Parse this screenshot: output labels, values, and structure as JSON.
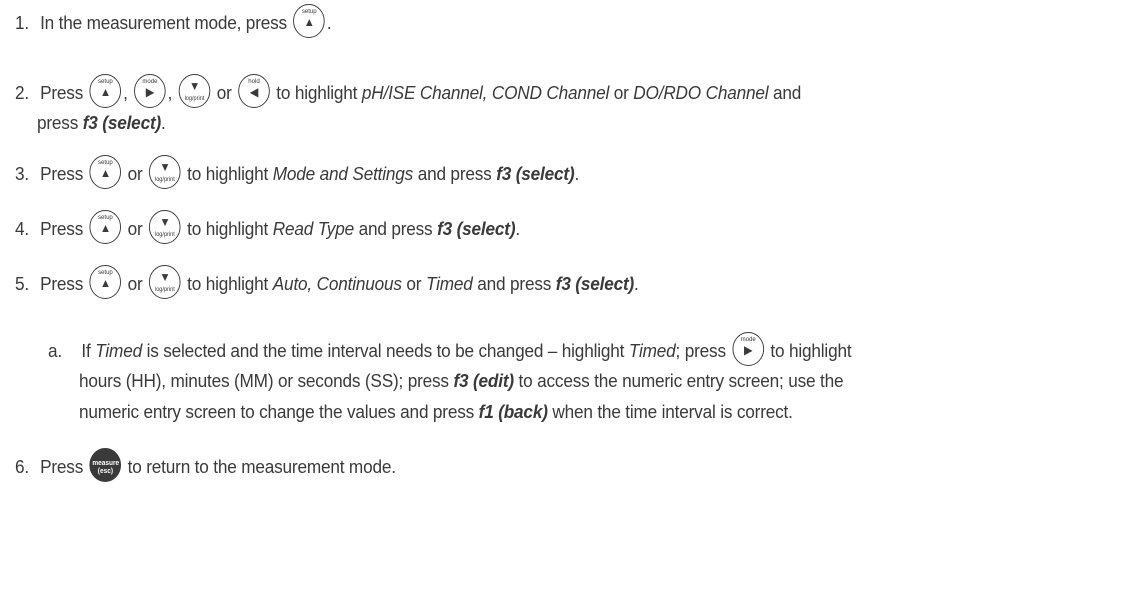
{
  "keys": {
    "setup": {
      "label": "setup",
      "glyph": "▲"
    },
    "mode": {
      "label": "mode",
      "glyph": "▶"
    },
    "logprint": {
      "label": "log/print",
      "glyph": "▼"
    },
    "hold": {
      "label": "hold",
      "glyph": "◀"
    },
    "measure": {
      "label_top": "measure",
      "label_bottom": "(esc)"
    }
  },
  "steps": [
    {
      "num": "1.",
      "t1": "In the measurement mode, press",
      "t2": "."
    },
    {
      "num": "2.",
      "t1": "Press",
      "sep1": ",",
      "sep2": ",",
      "or": "or",
      "t2": "to highlight",
      "opt1": "pH/ISE Channel, COND Channel",
      "or2": "or",
      "opt2": "DO/RDO Channel",
      "and": "and",
      "line2": "press",
      "action": "f3 (select)",
      "end": "."
    },
    {
      "num": "3.",
      "t1": "Press",
      "or": "or",
      "t2": "to highlight",
      "opt": "Mode and Settings",
      "t3": "and press",
      "action": "f3 (select)",
      "end": "."
    },
    {
      "num": "4.",
      "t1": "Press",
      "or": "or",
      "t2": "to highlight",
      "opt": "Read Type",
      "t3": "and press",
      "action": "f3 (select)",
      "end": "."
    },
    {
      "num": "5.",
      "t1": "Press",
      "or": "or",
      "t2": "to highlight",
      "opt1": "Auto, Continuous",
      "or2": "or",
      "opt2": "Timed",
      "t3": "and press",
      "action": "f3 (select)",
      "end": "."
    },
    {
      "num": "6.",
      "t1": "Press",
      "t2": "to return to the measurement mode."
    }
  ],
  "substep": {
    "letter": "a.",
    "t1": "If",
    "timed1": "Timed",
    "t2": "is selected and the time interval needs to be changed – highlight",
    "timed2": "Timed",
    "t3": "; press",
    "t4": "to highlight",
    "line2a": "hours (HH), minutes (MM) or seconds (SS); press",
    "edit": "f3 (edit)",
    "line2b": "to access the numeric entry screen; use the",
    "line3a": "numeric entry screen to change the values and press",
    "back": "f1 (back)",
    "line3b": "when the time interval is correct."
  }
}
